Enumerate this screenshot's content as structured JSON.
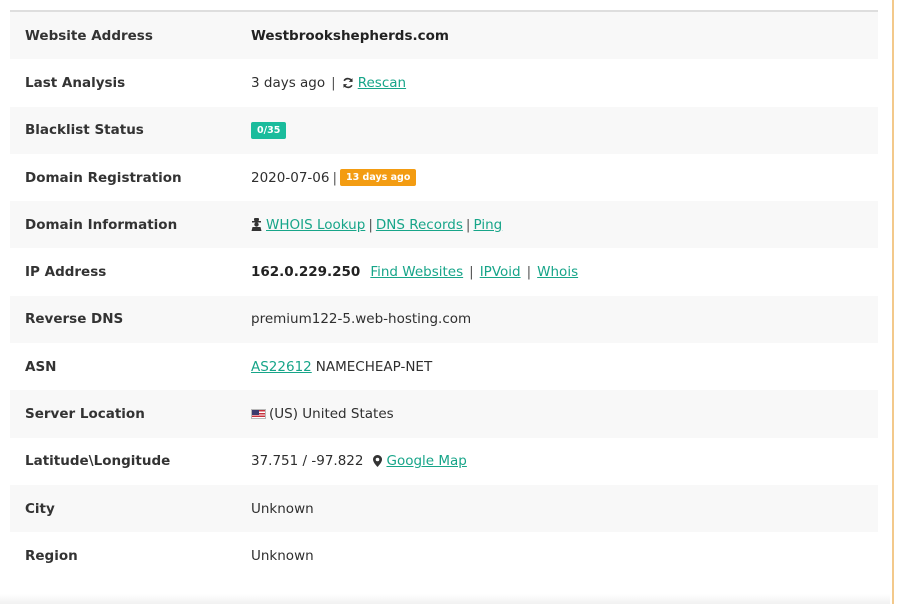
{
  "rows": {
    "website": {
      "label": "Website Address",
      "value": "Westbrookshepherds.com"
    },
    "last_analysis": {
      "label": "Last Analysis",
      "value": "3 days ago",
      "sep": "|",
      "rescan_label": "Rescan",
      "icon": "refresh-icon"
    },
    "blacklist": {
      "label": "Blacklist Status",
      "badge": "0/35",
      "badge_color": "#1abc9c"
    },
    "domain_registration": {
      "label": "Domain Registration",
      "date": "2020-07-06",
      "sep": "|",
      "badge": "13 days ago",
      "badge_color": "#f39c12"
    },
    "domain_information": {
      "label": "Domain Information",
      "icon": "user-secret-icon",
      "whois": "WHOIS Lookup",
      "dns": "DNS Records",
      "ping": "Ping",
      "sep": "|"
    },
    "ip_address": {
      "label": "IP Address",
      "ip": "162.0.229.250",
      "find": "Find Websites",
      "ipvoid": "IPVoid",
      "whois": "Whois",
      "sep": "|"
    },
    "reverse_dns": {
      "label": "Reverse DNS",
      "value": "premium122-5.web-hosting.com"
    },
    "asn": {
      "label": "ASN",
      "asn_link": "AS22612",
      "name": "NAMECHEAP-NET"
    },
    "server_location": {
      "label": "Server Location",
      "flag": "us-flag-icon",
      "value": "(US) United States"
    },
    "lat_long": {
      "label": "Latitude\\Longitude",
      "value": "37.751 / -97.822",
      "map_label": "Google Map",
      "icon": "map-marker-icon"
    },
    "city": {
      "label": "City",
      "value": "Unknown"
    },
    "region": {
      "label": "Region",
      "value": "Unknown"
    }
  },
  "colors": {
    "link": "#17a589",
    "green_badge": "#1abc9c",
    "orange_badge": "#f39c12"
  }
}
